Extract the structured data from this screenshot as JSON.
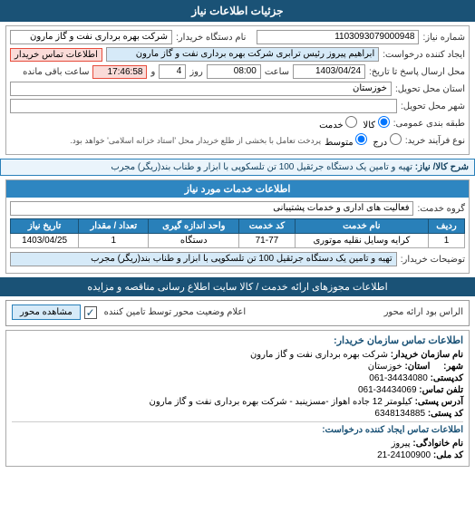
{
  "header": {
    "title": "جزئیات اطلاعات نیاز"
  },
  "info_section": {
    "title": "جزئیات اطلاعات نیاز",
    "number_label": "شماره نیاز:",
    "number_value": "1103093079000948",
    "supplier_label": "نام دستگاه خریدار:",
    "supplier_value": "شرکت بهره برداری نفت و گاز مارون",
    "contact_link": "اطلاعات تماس خریدار",
    "requester_label": "ایجاد کننده درخواست:",
    "requester_value": "ابراهیم پیروز رئیس ترابری شرکت بهره برداری نفت و گاز مارون",
    "send_date_label": "محل ارسال پاسخ تا تاریخ:",
    "send_date_value": "1403/04/24",
    "send_time_label": "ساعت",
    "send_time_value": "08:00",
    "days_label": "روز",
    "days_value": "4",
    "time_label": "و",
    "time_value": "17:46:58",
    "remaining_label": "ساعت باقی مانده",
    "province_label": "استان محل تحویل:",
    "province_value": "خوزستان",
    "city_label": "شهر محل تحویل:",
    "city_value": "",
    "freight_label": "طبقه بندی عمومی:",
    "freight_kala": "کالا",
    "freight_khadamat": "خدمت",
    "freight_selected": "کالا",
    "purchase_label": "نوع فرآیند خرید:",
    "purchase_opt1": "درج",
    "purchase_opt2": "متوسط",
    "purchase_opt3": "پردخت تعامل با بخشی از طلع خریدار محل 'استاد خزانه اسلامی' خواهد بود."
  },
  "kala_section": {
    "title": "شرح کالا/ نیاز:",
    "description": "تهیه و تامین یک دستگاه جرثقیل 100 تن تلسکوپی با ابزار و طناب بند(ریگر) مجرب"
  },
  "services_section": {
    "title": "اطلاعات خدمات مورد نیاز",
    "group_label": "گروه خدمت:",
    "group_value": "فعالیت های اداری و خدمات پشتیبانی",
    "table": {
      "headers": [
        "ردیف",
        "نام خدمت",
        "کد خدمت",
        "واحد اندازه گیری",
        "تعداد / مقدار",
        "تاریخ نیاز"
      ],
      "rows": [
        {
          "row": "1",
          "name": "کرایه وسایل نقلیه موتوری",
          "code": "71-77",
          "unit": "دستگاه",
          "qty": "1",
          "date": "1403/04/25"
        }
      ]
    },
    "desc_label": "توضیحات خریدار:",
    "desc_value": "تهیه و تامین یک دستگاه جرثقیل 100 تن تلسکوپی با ابزار و طناب بند(ریگر) مجرب"
  },
  "bottom_url": {
    "text": "اطلاعات مجوزهای ارائه خدمت / کالا      سایت اطلاع رسانی مناقصه و مزایده"
  },
  "bottom_link": {
    "text": "الراس بود اراده محور      اعلام وضعیت محور توسط تامین کننده"
  },
  "rasman": {
    "label": "الراس بود ارائه محور",
    "checkbox_checked": "✓",
    "view_button": "مشاهده محور"
  },
  "contact": {
    "title": "اطلاعات تماس سازمان خریدار:",
    "name_label": "نام سازمان خریدار:",
    "name_value": "شرکت بهره برداری نفت و گاز مارون",
    "city_label": "شهر:",
    "city_value": "",
    "province_label": "استان:",
    "province_value": "خوزستان",
    "postal_label": "کدپستی:",
    "postal_value": "34434080-061",
    "phone_label": "تلفن تماس:",
    "phone_value": "34434069-061",
    "address_label": "آدرس پستی:",
    "address_value": "کیلومتر 12 جاده اهواز -مسزینبد - شرکت بهره برداری نفت و گاز مارون",
    "zipcode_label": "کد پستی:",
    "zipcode_value": "6348134885",
    "divider": "",
    "requester_title": "اطلاعات تماس ایجاد کننده درخواست:",
    "req_name_label": "نام خانوادگی:",
    "req_name_value": "پیروز",
    "req_code_label": "کد ملی:",
    "req_code_value": "24100900-21"
  }
}
